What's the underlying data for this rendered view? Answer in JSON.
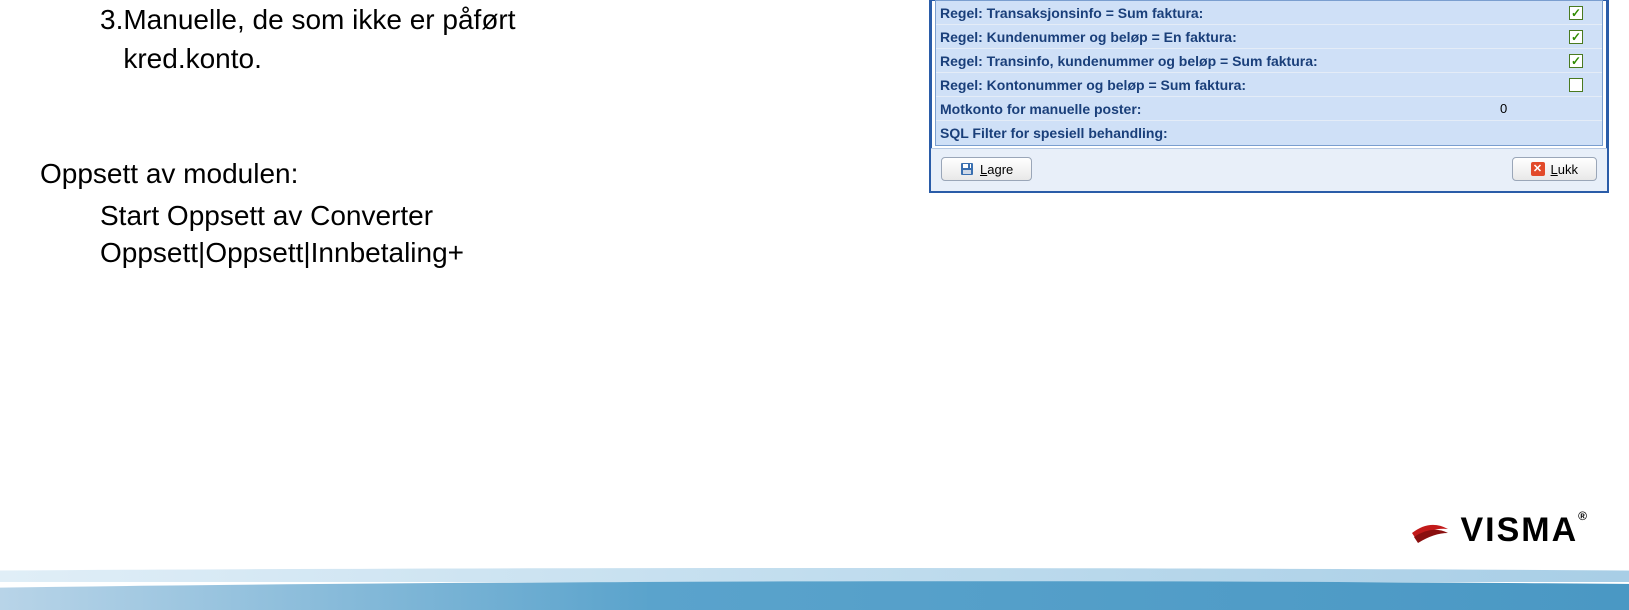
{
  "slide": {
    "item3_num": "3.",
    "item3_text": "Manuelle, de som ikke er påført kred.konto.",
    "heading": "Oppsett av modulen:",
    "sub_para": "Start Oppsett av Converter\nOppsett|Oppsett|Innbetaling+"
  },
  "dialog": {
    "rows": [
      {
        "label": "Regel: Transaksjonsinfo = Sum faktura:",
        "value": "",
        "checked": true,
        "hasCheckbox": true
      },
      {
        "label": "Regel: Kundenummer og beløp = En faktura:",
        "value": "",
        "checked": true,
        "hasCheckbox": true
      },
      {
        "label": "Regel: Transinfo, kundenummer og beløp = Sum faktura:",
        "value": "",
        "checked": true,
        "hasCheckbox": true
      },
      {
        "label": "Regel: Kontonummer og beløp = Sum faktura:",
        "value": "",
        "checked": false,
        "hasCheckbox": true
      },
      {
        "label": "Motkonto for manuelle poster:",
        "value": "0",
        "checked": false,
        "hasCheckbox": false
      },
      {
        "label": "SQL Filter for spesiell behandling:",
        "value": "",
        "checked": false,
        "hasCheckbox": false
      }
    ],
    "buttons": {
      "save": {
        "prefix": "L",
        "rest": "agre"
      },
      "close": {
        "prefix": "L",
        "rest": "ukk"
      }
    }
  },
  "logo": {
    "text": "VISMA",
    "reg": "®"
  }
}
